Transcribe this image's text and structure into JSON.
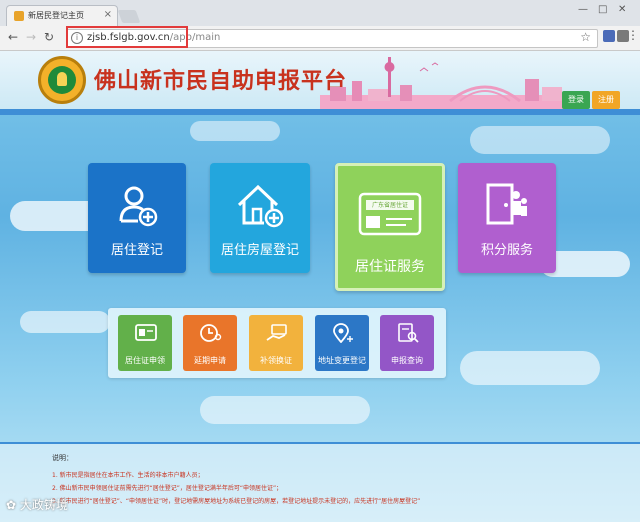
{
  "browser": {
    "tab_title": "新居民登记主页",
    "url_host": "zjsb.fslgb.gov.cn",
    "url_path": "/app/main"
  },
  "header": {
    "site_title": "佛山新市民自助申报平台",
    "login_label": "登录",
    "register_label": "注册"
  },
  "tiles": {
    "residence_registration": "居住登记",
    "housing_registration": "居住房屋登记",
    "residence_permit_service": "居住证服务",
    "card_badge": "广东省居住证",
    "points_service": "积分服务"
  },
  "submenu": {
    "apply": "居住证申领",
    "extend": "延期申请",
    "reissue": "补领换证",
    "address_change": "地址变更登记",
    "query": "申报查询"
  },
  "notes": {
    "heading": "说明：",
    "line1": "1. 新市民是指居住在本市工作、生活的非本市户籍人员；",
    "line2": "2. 佛山新市民申领居住证前需先进行“居住登记”，居住登记满半年后可“申领居住证”；",
    "line3": "3. 新市民进行“居住登记”、“申领居住证”时，登记地需房屋地址为系统已登记的房屋，若登记地址提示未登记的，应先进行“居住房屋登记”"
  },
  "watermark": "大政铸境",
  "colors": {
    "title_red": "#c8321e",
    "tile_blue": "#1b73c8",
    "tile_cyan": "#23a6dd",
    "tile_green": "#8fd25b",
    "tile_purple": "#b05fcf"
  }
}
